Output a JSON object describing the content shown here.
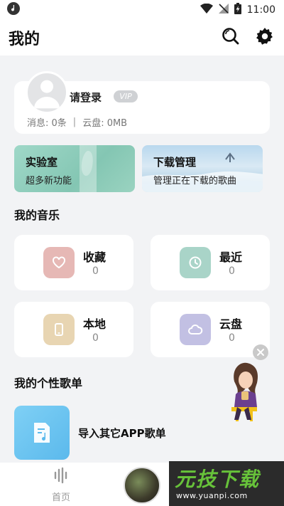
{
  "status_bar": {
    "time": "11:00"
  },
  "header": {
    "title": "我的"
  },
  "profile": {
    "login_text": "请登录",
    "vip_label": "VIP",
    "messages": "消息: 0条",
    "separator": "|",
    "cloud_usage": "云盘: 0MB"
  },
  "promos": [
    {
      "title": "实验室",
      "subtitle": "超多新功能"
    },
    {
      "title": "下载管理",
      "subtitle": "管理正在下载的歌曲"
    }
  ],
  "my_music": {
    "title": "我的音乐",
    "tiles": [
      {
        "label": "收藏",
        "count": "0",
        "icon": "heart-icon",
        "color": "#e6b8b5"
      },
      {
        "label": "最近",
        "count": "0",
        "icon": "clock-icon",
        "color": "#a9d4c8"
      },
      {
        "label": "本地",
        "count": "0",
        "icon": "phone-icon",
        "color": "#e8d5b2"
      },
      {
        "label": "云盘",
        "count": "0",
        "icon": "cloud-icon",
        "color": "#c2c0e3"
      }
    ]
  },
  "playlists": {
    "title": "我的个性歌单",
    "import_label": "导入其它APP歌单",
    "import_icon": "import-playlist-icon"
  },
  "bottom_nav": {
    "home_label": "首页"
  },
  "watermark": {
    "brand": "元技下载",
    "url": "www.yuanpi.com"
  }
}
